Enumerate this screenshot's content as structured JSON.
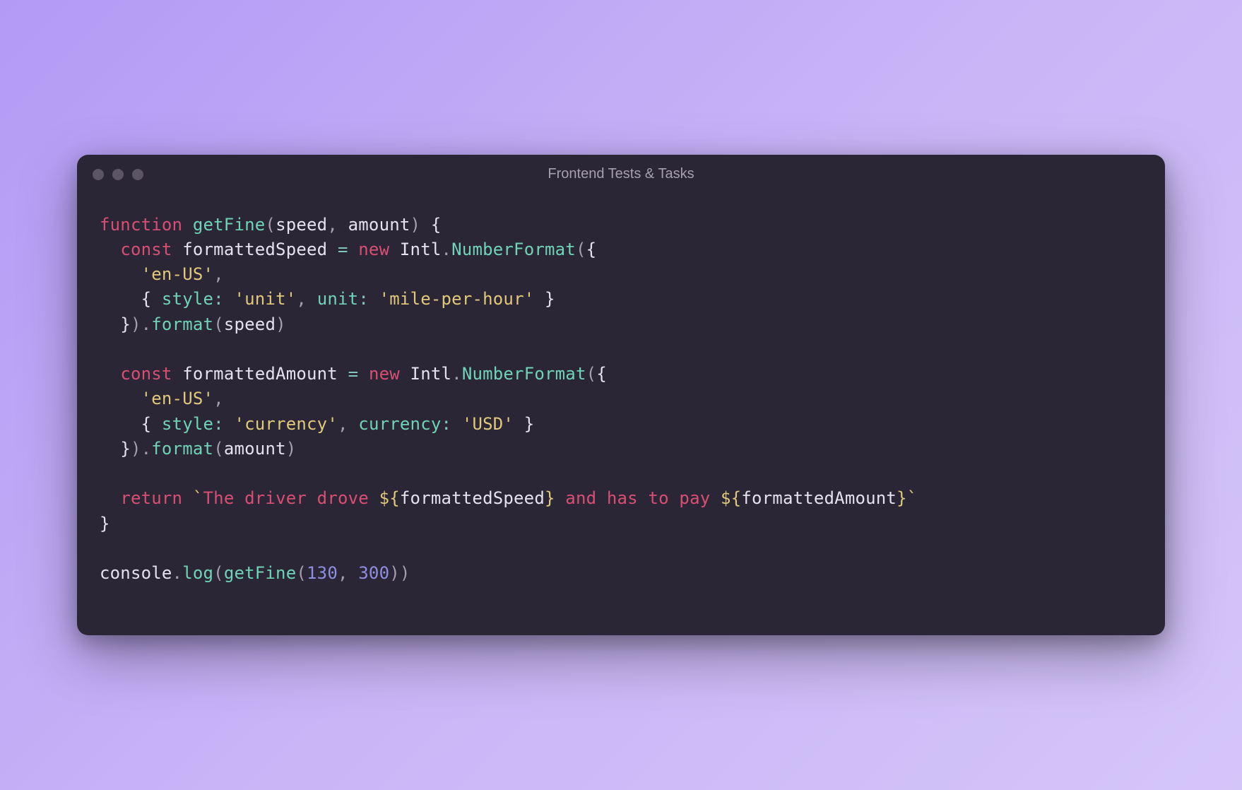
{
  "window": {
    "title": "Frontend Tests & Tasks"
  },
  "code": {
    "tokens": [
      [
        [
          "kw",
          "function"
        ],
        [
          "pn",
          " "
        ],
        [
          "fn",
          "getFine"
        ],
        [
          "pn",
          "("
        ],
        [
          "id",
          "speed"
        ],
        [
          "pn",
          ", "
        ],
        [
          "id",
          "amount"
        ],
        [
          "pn",
          ") "
        ],
        [
          "br",
          "{"
        ]
      ],
      [
        [
          "pn",
          "  "
        ],
        [
          "kw",
          "const"
        ],
        [
          "pn",
          " "
        ],
        [
          "id",
          "formattedSpeed"
        ],
        [
          "pn",
          " "
        ],
        [
          "op",
          "="
        ],
        [
          "pn",
          " "
        ],
        [
          "kw",
          "new"
        ],
        [
          "pn",
          " "
        ],
        [
          "cls",
          "Intl"
        ],
        [
          "pn",
          "."
        ],
        [
          "fn",
          "NumberFormat"
        ],
        [
          "pn",
          "("
        ],
        [
          "br",
          "{"
        ]
      ],
      [
        [
          "pn",
          "    "
        ],
        [
          "str",
          "'en-US'"
        ],
        [
          "pn",
          ","
        ]
      ],
      [
        [
          "pn",
          "    "
        ],
        [
          "br",
          "{"
        ],
        [
          "pn",
          " "
        ],
        [
          "prop",
          "style"
        ],
        [
          "op",
          ":"
        ],
        [
          "pn",
          " "
        ],
        [
          "str",
          "'unit'"
        ],
        [
          "pn",
          ", "
        ],
        [
          "prop",
          "unit"
        ],
        [
          "op",
          ":"
        ],
        [
          "pn",
          " "
        ],
        [
          "str",
          "'mile-per-hour'"
        ],
        [
          "pn",
          " "
        ],
        [
          "br",
          "}"
        ]
      ],
      [
        [
          "pn",
          "  "
        ],
        [
          "br",
          "}"
        ],
        [
          "pn",
          ")."
        ],
        [
          "fn",
          "format"
        ],
        [
          "pn",
          "("
        ],
        [
          "id",
          "speed"
        ],
        [
          "pn",
          ")"
        ]
      ],
      [],
      [
        [
          "pn",
          "  "
        ],
        [
          "kw",
          "const"
        ],
        [
          "pn",
          " "
        ],
        [
          "id",
          "formattedAmount"
        ],
        [
          "pn",
          " "
        ],
        [
          "op",
          "="
        ],
        [
          "pn",
          " "
        ],
        [
          "kw",
          "new"
        ],
        [
          "pn",
          " "
        ],
        [
          "cls",
          "Intl"
        ],
        [
          "pn",
          "."
        ],
        [
          "fn",
          "NumberFormat"
        ],
        [
          "pn",
          "("
        ],
        [
          "br",
          "{"
        ]
      ],
      [
        [
          "pn",
          "    "
        ],
        [
          "str",
          "'en-US'"
        ],
        [
          "pn",
          ","
        ]
      ],
      [
        [
          "pn",
          "    "
        ],
        [
          "br",
          "{"
        ],
        [
          "pn",
          " "
        ],
        [
          "prop",
          "style"
        ],
        [
          "op",
          ":"
        ],
        [
          "pn",
          " "
        ],
        [
          "str",
          "'currency'"
        ],
        [
          "pn",
          ", "
        ],
        [
          "prop",
          "currency"
        ],
        [
          "op",
          ":"
        ],
        [
          "pn",
          " "
        ],
        [
          "str",
          "'USD'"
        ],
        [
          "pn",
          " "
        ],
        [
          "br",
          "}"
        ]
      ],
      [
        [
          "pn",
          "  "
        ],
        [
          "br",
          "}"
        ],
        [
          "pn",
          ")."
        ],
        [
          "fn",
          "format"
        ],
        [
          "pn",
          "("
        ],
        [
          "id",
          "amount"
        ],
        [
          "pn",
          ")"
        ]
      ],
      [],
      [
        [
          "pn",
          "  "
        ],
        [
          "kw",
          "return"
        ],
        [
          "pn",
          " "
        ],
        [
          "str",
          "`"
        ],
        [
          "tpl",
          "The driver drove "
        ],
        [
          "str",
          "${"
        ],
        [
          "tplv",
          "formattedSpeed"
        ],
        [
          "str",
          "}"
        ],
        [
          "tpl",
          " and has to pay "
        ],
        [
          "str",
          "${"
        ],
        [
          "tplv",
          "formattedAmount"
        ],
        [
          "str",
          "}"
        ],
        [
          "str",
          "`"
        ]
      ],
      [
        [
          "br",
          "}"
        ]
      ],
      [],
      [
        [
          "id",
          "console"
        ],
        [
          "pn",
          "."
        ],
        [
          "fn",
          "log"
        ],
        [
          "pn",
          "("
        ],
        [
          "fn",
          "getFine"
        ],
        [
          "pn",
          "("
        ],
        [
          "num",
          "130"
        ],
        [
          "pn",
          ", "
        ],
        [
          "num",
          "300"
        ],
        [
          "pn",
          "))"
        ]
      ]
    ]
  }
}
